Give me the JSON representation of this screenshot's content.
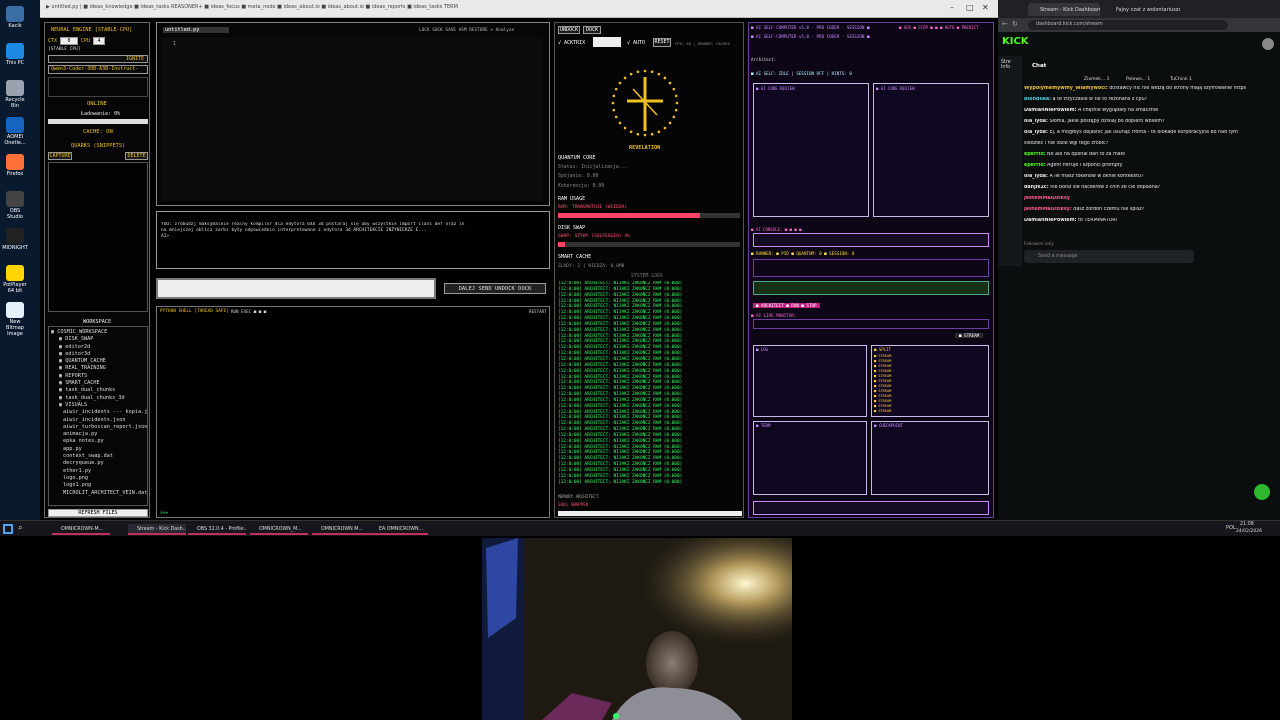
{
  "desktop": {
    "icons": [
      {
        "label": "Kacik",
        "color": "#3a6ea5"
      },
      {
        "label": "This PC",
        "color": "#1e88e5"
      },
      {
        "label": "Recycle Bin",
        "color": "#9aa3ad"
      },
      {
        "label": "AOMEI Onetle...",
        "color": "#1565c0"
      },
      {
        "label": "Firefox",
        "color": "#ff7139"
      },
      {
        "label": "OBS Studio",
        "color": "#444444"
      },
      {
        "label": "MIDNIGHT",
        "color": "#222222"
      },
      {
        "label": "PotPlayer 64 bit",
        "color": "#ffd600"
      },
      {
        "label": "New Bitmap Image",
        "color": "#e3f2fd"
      }
    ]
  },
  "app": {
    "tabs": "▶ untitled.py   |  ■ ideas_knowledge   ■ ideas_tasks   REASONER+   ■ ideas_focus   ■ meta_node   ■ ideas_about.io   ■ ideas_about.io   ■ ideas_reports   ■ ideas_tasks   TERM",
    "left": {
      "title": "NEURAL ENGINE [STABLE-CPU]",
      "ctx_label": "CTX",
      "ctx_value": "8",
      "cpu_label": "CPU",
      "cpu_value": "4",
      "stable_label": "[STABLE CPU]",
      "ignite": "IGNITE",
      "model": "Qwen3-Coder-30B-A3B-Instruct-UD-Q8_",
      "online": "ONLINE",
      "loading": "Ładowanie: 0%",
      "cache": "CACHE: ON",
      "quarks": "QUARKS (SNIPPETS)",
      "capture": "CAPTURE",
      "delete": "DELETE",
      "workspace": "WORKSPACE",
      "tree": [
        "▣ COSMIC_WORKSPACE",
        "▣ DISK_SWAP",
        "▣ editor2d",
        "▣ editor3d",
        "▣ QUANTUM_CACHE",
        "▣ REAL_TRAINING",
        "▣ REPORTS",
        "▣ SMART_CACHE",
        "▣ task_dual_chunks",
        "▣ task_dual_chunks_3d",
        "▣ VISUALS",
        "aiwir_incidents --- kopia.json",
        "aiwir_incidents.json",
        "aiwir_turboscan_report.json",
        "animacja.py",
        "epka notes.py",
        "app.py",
        "context_swap.dat",
        "decryqueue.py",
        "ether1.py",
        "logo.png",
        "logo1.png",
        "MICROLIT_ARCHITECT_VEIN.dat"
      ],
      "refresh": "REFRESH FILES"
    },
    "editor": {
      "title": "untitled.py",
      "toolbar": "LOCK  SOCK  SAVE  ASM  RESTORE  ✕ Analyze",
      "line": "1",
      "prompt_text": "YOU: zrobudzj maksymalnie realny kompilor dla edytora 64d 3d postaraj się aby wszystkie import class def oraz in\nna mniejszej oblicz zarbi były odpowiednio interpretowane z edytora 3d ARCHITEKCIE INŻYNIERZE E...\nAI>",
      "actions": "DALEJ  SEND  UNDOCK  DOCK",
      "shell_title": "PYTHON SHELL [THREAD SAFE]",
      "shell_btns": "RUN  EXEC  ■  ■  ■",
      "restart": "RESTART",
      "shell_prompt": ">>>"
    },
    "core": {
      "undock": "UNDOCK",
      "dock": "DOCK",
      "acktrix": "√ ACKTRIX",
      "auto": "√ AUTO",
      "reset": "RESET",
      "status_line": "FPS: 60  |  RENDER: CACHED",
      "revelation": "REVELATION",
      "qcore": "QUANTUM CORE",
      "status": "Status: Inicjalizacja...",
      "spojanie": "Spójanie: 0.00",
      "koherencja": "Koherencja: 0.00",
      "ram_usage": "RAM USAGE",
      "ram_text": "RAM: TRANSMUTUJE (WIEDZA)",
      "ram_fill": 0.78,
      "disk_swap": "DISK SWAP",
      "swap_text": "SWAP: OŻYWY (SOLFEGGIO) 4%",
      "swap_fill": 0.04,
      "smart_cache": "SMART CACHE",
      "slady": "ŚLADY: 2 | WIEDZA: 0.0MB",
      "syslogs": "SYSTEM LOGS",
      "log_line": "[12:0:00] ARCHITECT: NIJAKI ZAKOŃCZ RAM (0.000)",
      "memory": "MEMORY ARCHITECT",
      "log_status": "SOUL SWAPPED"
    },
    "purple": {
      "title": "■ AI SELF-COMPUTER v5.0 · PRO CODER · SESSION ■",
      "header_btns": "■ ACK  ■ STOP  ■ ■ ■ AUTO  ■ PREDICT",
      "architect": "Architect:",
      "session": "■ AI SELF: IDLE | SESSION OFF | HINTS: 0",
      "pane_a": "■ AI CODE REVIEW",
      "pane_b": "■ AI CODE REVIEW",
      "row2": "■ RUNNER: ■ PID ■ QUANTUM: 0 ■ SESSION: 0",
      "console": "■ AI CONSOLE: ■ ■ ■ ■",
      "red_tab": "■ ARCHITECT  ■ RUN  ■ STOP",
      "ai_live": "■ AI LIVE MONITOR:",
      "stream": "■ STREAM",
      "mini_a": "■ LOG",
      "mini_b": "■ SPLIT",
      "mini_c": "■ TERM",
      "mini_d": "■ CHECKPOINT"
    }
  },
  "kick": {
    "tabs": [
      "Stream - Kick Dashboard",
      "Fajny czat z wolontariuszami"
    ],
    "address": "dashboard.kick.com/stream",
    "logo": "KICK",
    "chat_title": "Chat",
    "stream_info": "Stre Info",
    "viewers": [
      "Ziomek... 1",
      "Polewo... 1",
      "TuChink 1"
    ],
    "messages": [
      {
        "user": "Wypolymemywmy_Wlamywoci:",
        "text": " dostawcy nic nie widzą bo strony mają szyfrowanie https",
        "color": "#f0c040"
      },
      {
        "user": "Blondiika:",
        "text": " a te trzyczasie w tle to rezonans z cpu?",
        "color": "#4dd0e1"
      },
      {
        "user": "DamianNiePowiem:",
        "text": " A chętnie wyglądały na smacznie",
        "color": "#e8e8e8"
      },
      {
        "user": "ola_lyda:",
        "text": " Słoma, jakie postępy dzisiaj bo dopiero wbiłem?",
        "color": "#e8e8e8"
      },
      {
        "user": "ola_lyda:",
        "text": " Ej, a mogłbys objaśnić jak usunąć fronta - te blokade korporacyjna bo nad tym",
        "color": "#e8e8e8"
      },
      {
        "user": "",
        "text": "siedzieć i nie idzie wgl tego zrobić?",
        "color": "#e8e8e8"
      },
      {
        "user": "eperrio:",
        "text": " No ale na openai dan to za mało",
        "color": "#53fc18"
      },
      {
        "user": "eperrio:",
        "text": " Agent filtruje i szponci prompty",
        "color": "#53fc18"
      },
      {
        "user": "ola_lyda:",
        "text": " A ile masz tokenów w oknie kontekstu?",
        "color": "#e8e8e8"
      },
      {
        "user": "danjik2c:",
        "text": " nie bolsz sie hackerow z chin ze cie dopadna?",
        "color": "#e8e8e8"
      },
      {
        "user": "JestemMalDzIksy",
        "text": "",
        "color": "#ff5c8a"
      },
      {
        "user": "JestemMalDzIksy:",
        "text": " dasz zordon czemu nie śpisz?",
        "color": "#ff5c8a"
      },
      {
        "user": "DamianNiePowiem:",
        "text": " to TERMINATOR!",
        "color": "#e8e8e8"
      }
    ],
    "followers_only": "Followers only",
    "send_placeholder": "Send a message"
  },
  "taskbar": {
    "items": [
      "OMNICROWN-M...",
      "Stream - Kick Dash...",
      "OBS 32.0.4 - Profile:...",
      "OMNICROWN_M...",
      "OMNICROWN M...",
      "EA OMNICROWN..."
    ],
    "lang": "POL",
    "time": "21:08",
    "date": "24/02/2026"
  }
}
